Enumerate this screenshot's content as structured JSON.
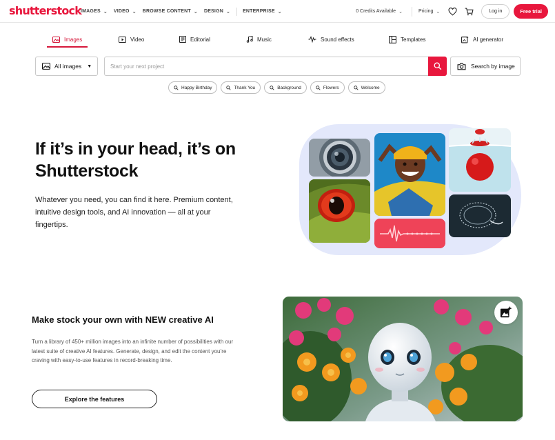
{
  "brand": {
    "logo_text": "shutterstock",
    "accent": "#e8173d"
  },
  "nav": {
    "links": [
      "IMAGES",
      "VIDEO",
      "BROWSE CONTENT",
      "DESIGN",
      "ENTERPRISE"
    ],
    "credits": "0 Credits Available",
    "pricing": "Pricing",
    "login": "Log in",
    "free_trial": "Free trial"
  },
  "tabs": [
    "Images",
    "Video",
    "Editorial",
    "Music",
    "Sound effects",
    "Templates",
    "AI generator"
  ],
  "search": {
    "filter_label": "All images",
    "placeholder": "Start your next project",
    "search_by_image": "Search by image"
  },
  "chips": [
    "Happy Birthday",
    "Thank You",
    "Background",
    "Flowers",
    "Welcome"
  ],
  "hero": {
    "title": "If it’s in your head, it’s on Shutterstock",
    "description": "Whatever you need, you can find it here. Premium content, intuitive design tools, and AI innovation — all at your fingertips."
  },
  "ai_section": {
    "title": "Make stock your own with NEW creative AI",
    "description": "Turn a library of 450+ million images into an infinite number of possibilities with our latest suite of creative AI features. Generate, design, and edit the content you’re craving with easy-to-use features in record-breaking time.",
    "button": "Explore the features"
  }
}
